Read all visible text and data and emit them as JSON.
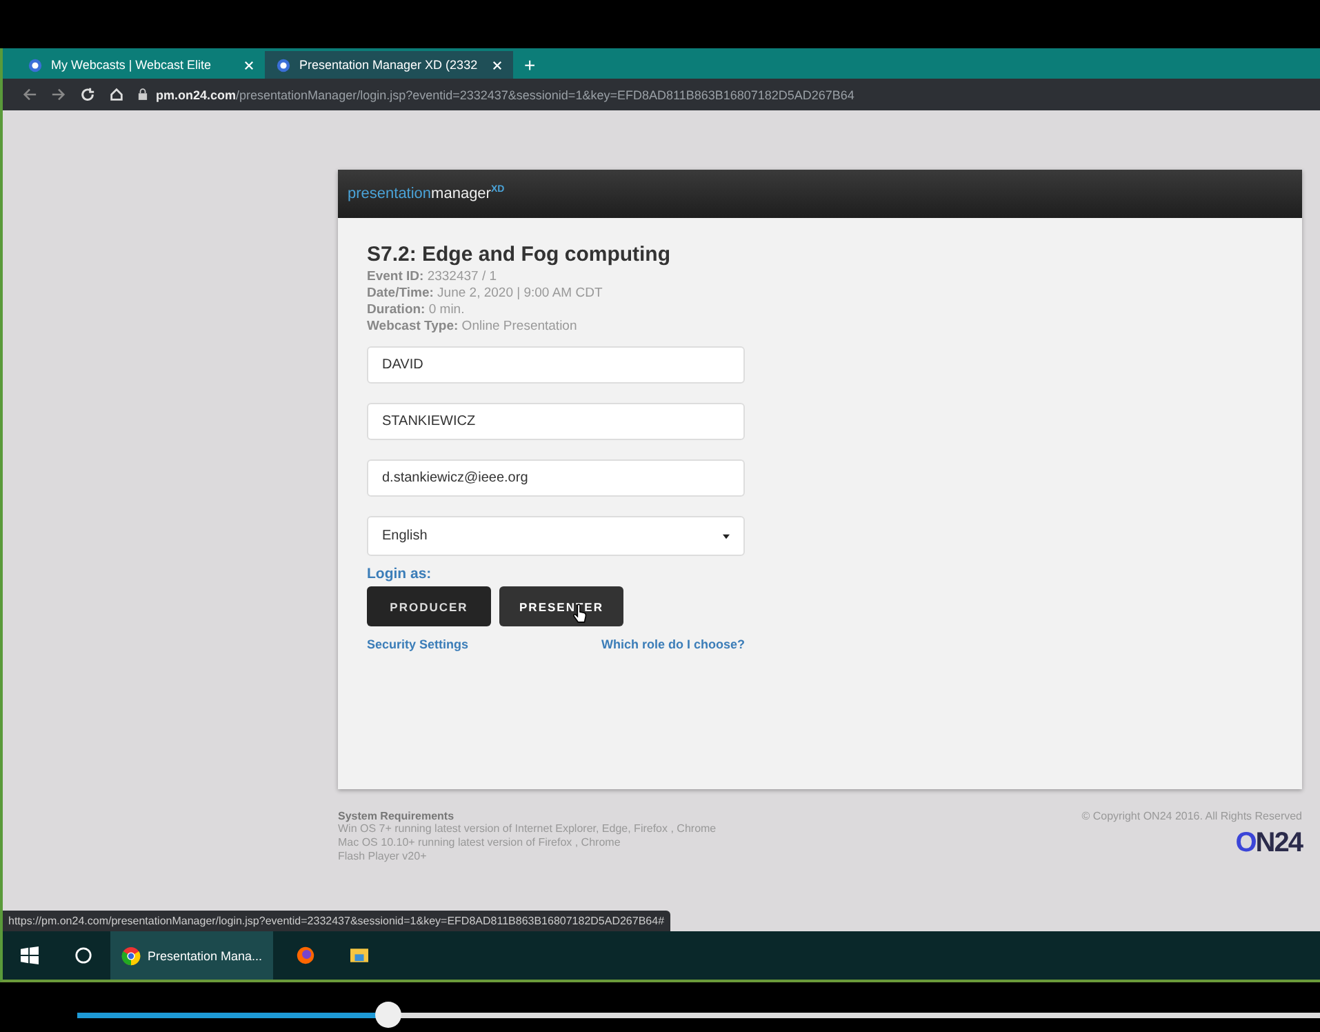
{
  "browser": {
    "tabs": [
      {
        "title": "My Webcasts | Webcast Elite",
        "selected": false
      },
      {
        "title": "Presentation Manager XD (2332",
        "selected": true
      }
    ],
    "new_tab": "+",
    "url_host": "pm.on24.com",
    "url_path": "/presentationManager/login.jsp?eventid=2332437&sessionid=1&key=EFD8AD811B863B16807182D5AD267B64"
  },
  "card": {
    "brand_light": "presentation",
    "brand_bold": "manager",
    "brand_sup": "XD",
    "title": "S7.2: Edge and Fog computing",
    "details": [
      {
        "label": "Event ID:",
        "value": "2332437 / 1"
      },
      {
        "label": "Date/Time:",
        "value": "June 2, 2020 | 9:00 AM CDT"
      },
      {
        "label": "Duration:",
        "value": "0 min."
      },
      {
        "label": "Webcast Type:",
        "value": "Online Presentation"
      }
    ],
    "fields": [
      {
        "value": "DAVID"
      },
      {
        "value": "STANKIEWICZ"
      },
      {
        "value": "d.stankiewicz@ieee.org"
      }
    ],
    "language": "English",
    "login_as": "Login as:",
    "buttons": [
      {
        "label": "PRODUCER",
        "hovered": false
      },
      {
        "label": "PRESENTER",
        "hovered": true
      }
    ],
    "links": [
      "Security Settings",
      "Which role do I choose?"
    ]
  },
  "footer": {
    "heading": "System Requirements",
    "lines": [
      "Win OS 7+ running latest version of Internet Explorer, Edge, Firefox , Chrome",
      "Mac OS 10.10+ running latest version of Firefox , Chrome",
      "Flash Player v20+"
    ],
    "copyright": "© Copyright ON24 2016. All Rights Reserved",
    "logo_accent": "O",
    "logo_rest": "N24"
  },
  "status_url": "https://pm.on24.com/presentationManager/login.jsp?eventid=2332437&sessionid=1&key=EFD8AD811B863B16807182D5AD267B64#",
  "taskbar": {
    "app": "Presentation Mana..."
  },
  "player": {
    "level": 0.25
  }
}
